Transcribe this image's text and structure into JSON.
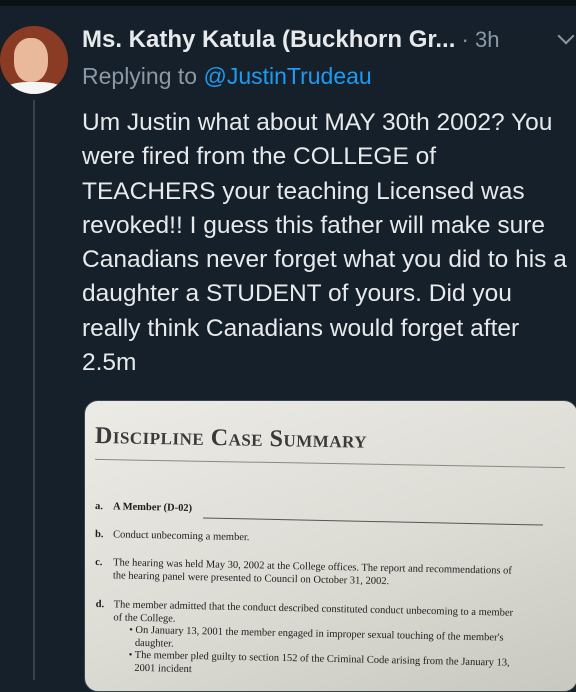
{
  "tweet": {
    "author_name": "Ms. Kathy Katula (Buckhorn Gr...",
    "separator": " · ",
    "time": "3h",
    "replying_prefix": "Replying to ",
    "replying_handle": "@JustinTrudeau",
    "text": "Um Justin what about MAY 30th 2002? You were fired from the COLLEGE of TEACHERS your teaching Licensed was revoked!! I guess this father will make sure Canadians never forget what you did to his a daughter a STUDENT of yours. Did you really think Canadians would forget after 2.5m"
  },
  "document": {
    "title": "Discipline Case Summary",
    "sections": {
      "a": {
        "label": "a.",
        "text": "A Member (D-02)"
      },
      "b": {
        "label": "b.",
        "text": "Conduct unbecoming a member."
      },
      "c": {
        "label": "c.",
        "text": "The hearing was held May 30, 2002 at the College offices. The report and recommendations of the hearing panel were presented to Council on October 31, 2002."
      },
      "d": {
        "label": "d.",
        "text": "The member admitted that the conduct described constituted conduct unbecoming to a member of the College.",
        "bullets": [
          "On January 13, 2001 the member engaged in improper sexual touching of the member's daughter.",
          "The member pled guilty to section 152 of the Criminal Code arising from the January 13, 2001 incident"
        ]
      }
    }
  }
}
